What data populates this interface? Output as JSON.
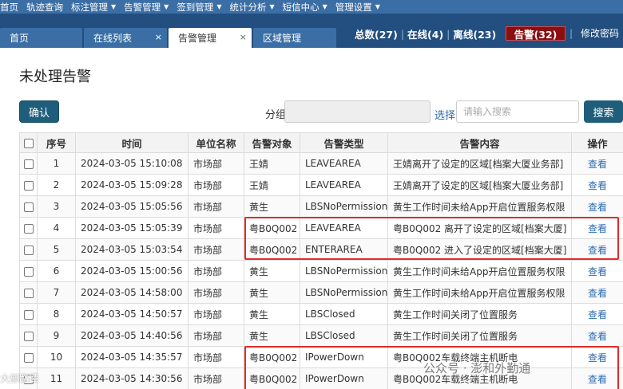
{
  "topnav": [
    {
      "label": "首页",
      "caret": false
    },
    {
      "label": "轨迹查询",
      "caret": false
    },
    {
      "label": "标注管理",
      "caret": true
    },
    {
      "label": "告警管理",
      "caret": true
    },
    {
      "label": "签到管理",
      "caret": true
    },
    {
      "label": "统计分析",
      "caret": true
    },
    {
      "label": "短信中心",
      "caret": true
    },
    {
      "label": "管理设置",
      "caret": true
    }
  ],
  "tabs": [
    {
      "label": "首页"
    },
    {
      "label": "在线列表",
      "close": "×"
    },
    {
      "label": "告警管理",
      "close": "×"
    },
    {
      "label": "区域管理"
    }
  ],
  "status": {
    "total": "总数(27)",
    "online": "在线(4)",
    "offline": "离线(23)",
    "alarm": "告警(32)",
    "change_password": "修改密码",
    "separator": "|"
  },
  "page": {
    "title": "未处理告警",
    "confirm_label": "确认",
    "group_label": "分组",
    "select_link": "选择",
    "search_placeholder": "请输入搜索",
    "search_label": "搜索"
  },
  "table": {
    "headers": [
      "序号",
      "时间",
      "单位名称",
      "告警对象",
      "告警类型",
      "告警内容",
      "操作"
    ],
    "rows": [
      {
        "no": "1",
        "time": "2024-03-05 15:10:08",
        "unit": "市场部",
        "target": "王婧",
        "type": "LEAVEAREA",
        "content": "王婧离开了设定的区域[档案大厦业务部]",
        "action": "查看"
      },
      {
        "no": "2",
        "time": "2024-03-05 15:09:28",
        "unit": "市场部",
        "target": "王婧",
        "type": "LEAVEAREA",
        "content": "王婧离开了设定的区域[档案大厦业务部]",
        "action": "查看"
      },
      {
        "no": "3",
        "time": "2024-03-05 15:05:56",
        "unit": "市场部",
        "target": "黄生",
        "type": "LBSNoPermission",
        "content": "黄生工作时间未给App开启位置服务权限",
        "action": "查看"
      },
      {
        "no": "4",
        "time": "2024-03-05 15:05:39",
        "unit": "市场部",
        "target": "粤B0Q002",
        "type": "LEAVEAREA",
        "content": "粤B0Q002 离开了设定的区域[档案大厦]",
        "action": "查看"
      },
      {
        "no": "5",
        "time": "2024-03-05 15:03:54",
        "unit": "市场部",
        "target": "粤B0Q002",
        "type": "ENTERAREA",
        "content": "粤B0Q002 进入了设定的区域[档案大厦]",
        "action": "查看"
      },
      {
        "no": "6",
        "time": "2024-03-05 15:00:56",
        "unit": "市场部",
        "target": "黄生",
        "type": "LBSNoPermission",
        "content": "黄生工作时间未给App开启位置服务权限",
        "action": "查看"
      },
      {
        "no": "7",
        "time": "2024-03-05 14:58:00",
        "unit": "市场部",
        "target": "黄生",
        "type": "LBSNoPermission",
        "content": "黄生工作时间未给App开启位置服务权限",
        "action": "查看"
      },
      {
        "no": "8",
        "time": "2024-03-05 14:50:57",
        "unit": "市场部",
        "target": "黄生",
        "type": "LBSClosed",
        "content": "黄生工作时间关闭了位置服务",
        "action": "查看"
      },
      {
        "no": "9",
        "time": "2024-03-05 14:40:56",
        "unit": "市场部",
        "target": "黄生",
        "type": "LBSClosed",
        "content": "黄生工作时间关闭了位置服务",
        "action": "查看"
      },
      {
        "no": "10",
        "time": "2024-03-05 14:35:57",
        "unit": "市场部",
        "target": "粤B0Q002",
        "type": "IPowerDown",
        "content": "粤B0Q002车载终端主机断电",
        "action": "查看"
      },
      {
        "no": "11",
        "time": "2024-03-05 14:30:56",
        "unit": "市场部",
        "target": "粤B0Q002",
        "type": "IPowerDown",
        "content": "粤B0Q002车载终端主机断电",
        "action": "查看"
      }
    ]
  },
  "watermarks": {
    "left": "大部路谭",
    "right": "公众号 · 澎和外勤通"
  },
  "colors": {
    "topnav_bg": "#3b6ea5",
    "tabbar_bg": "#234f80",
    "alarm_bg": "#8b0f12",
    "button_bg": "#1f5e7b",
    "highlight": "#e02b2b",
    "link": "#2a6bb0"
  }
}
